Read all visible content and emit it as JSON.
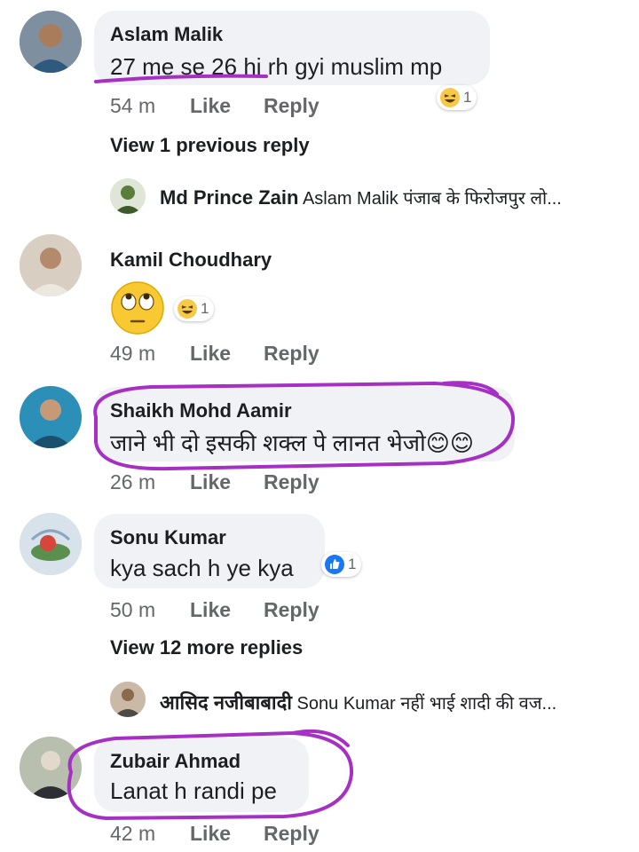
{
  "comments": [
    {
      "author": "Aslam Malik",
      "text": "27 me se 26 hi rh gyi muslim mp",
      "time": "54 m",
      "like": "Like",
      "reply": "Reply",
      "reaction": {
        "icon": "haha-reaction-icon",
        "count": "1"
      }
    },
    {
      "author": "Kamil Choudhary",
      "time": "49 m",
      "like": "Like",
      "reply": "Reply",
      "sticker_icon": "eye-roll-emoji-icon",
      "reaction": {
        "icon": "haha-reaction-icon",
        "count": "1"
      }
    },
    {
      "author": "Shaikh Mohd Aamir",
      "text": "जाने भी दो इसकी शक्ल पे लानत भेजो😊😊",
      "time": "26 m",
      "like": "Like",
      "reply": "Reply"
    },
    {
      "author": "Sonu Kumar",
      "text": "kya sach h ye kya",
      "time": "50 m",
      "like": "Like",
      "reply": "Reply",
      "reaction": {
        "icon": "like-reaction-icon",
        "count": "1"
      }
    },
    {
      "author": "Zubair Ahmad",
      "text": "Lanat h randi pe",
      "time": "42 m",
      "like": "Like",
      "reply": "Reply"
    }
  ],
  "view_previous": "View 1 previous reply",
  "view_more": "View 12 more replies",
  "nested_replies": [
    {
      "author": "Md Prince Zain",
      "preview": "Aslam Malik पंजाब के फिरोजपुर लो..."
    },
    {
      "author": "आसिद नजीबाबादी",
      "preview": "Sonu Kumar नहीं भाई शादी की वज..."
    }
  ],
  "colors": {
    "bubble": "#f0f2f5",
    "meta_text": "#65676b",
    "annotation_ink": "#a62fc4",
    "like_blue": "#1877f2"
  }
}
